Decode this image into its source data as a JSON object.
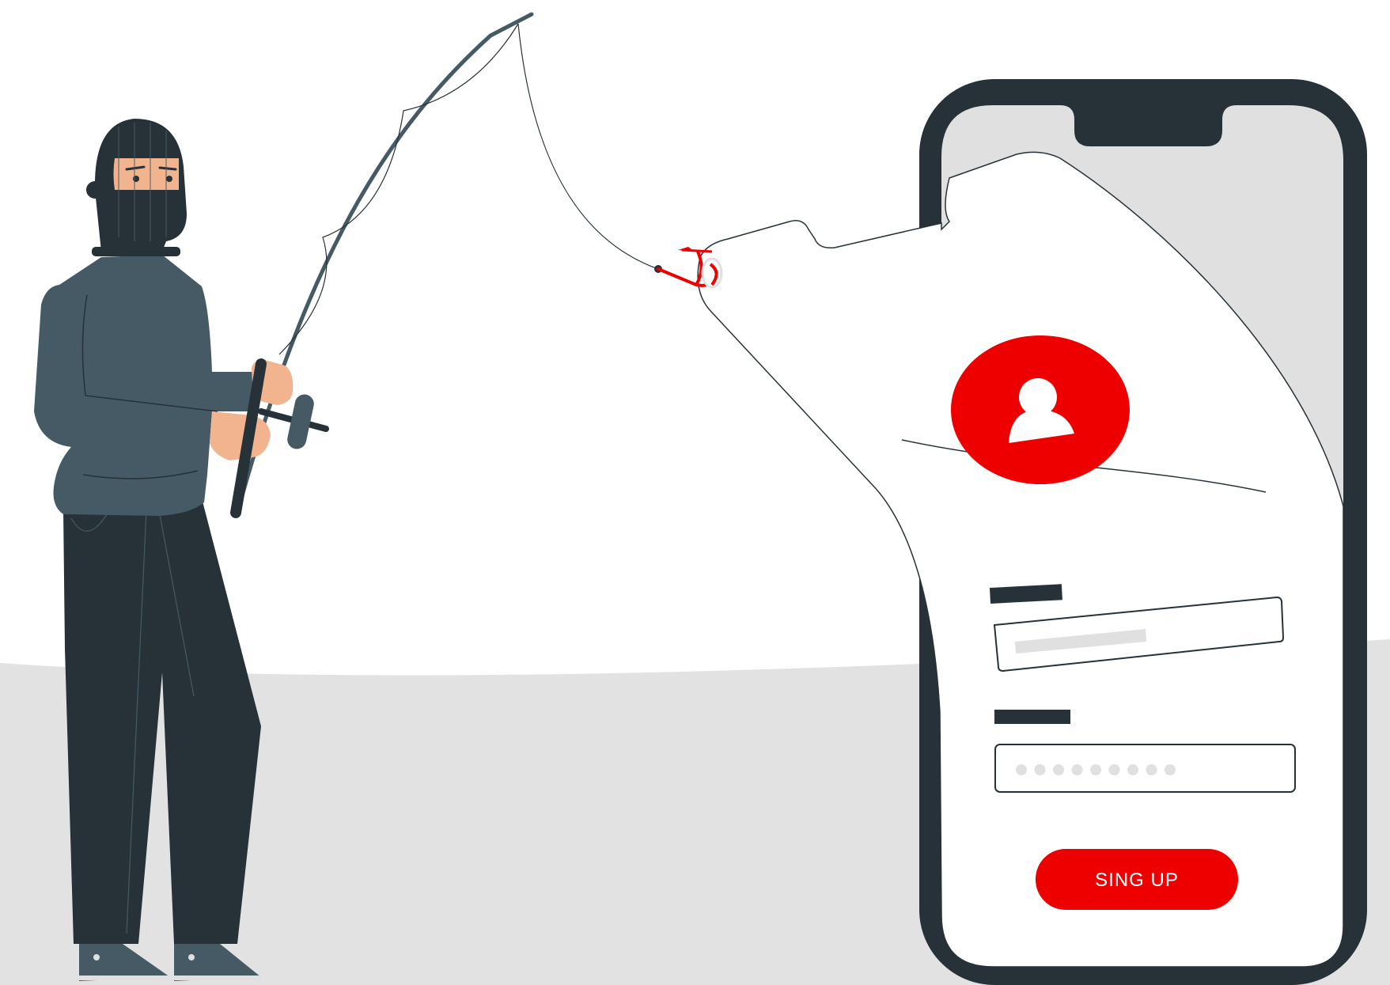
{
  "colors": {
    "background": "#ffffff",
    "ground": "#e2e2e2",
    "phone_frame": "#263238",
    "phone_screen": "#e0e0e0",
    "accent_red": "#ee0000",
    "sweater": "#455a64",
    "pants": "#263238",
    "skin": "#f2b48f",
    "field_placeholder": "#e0e0e0"
  },
  "icons": {
    "avatar": "user-avatar-icon",
    "hook": "fishing-hook-icon"
  },
  "form": {
    "submit_label": "SING UP",
    "password_mask_count": 9
  }
}
